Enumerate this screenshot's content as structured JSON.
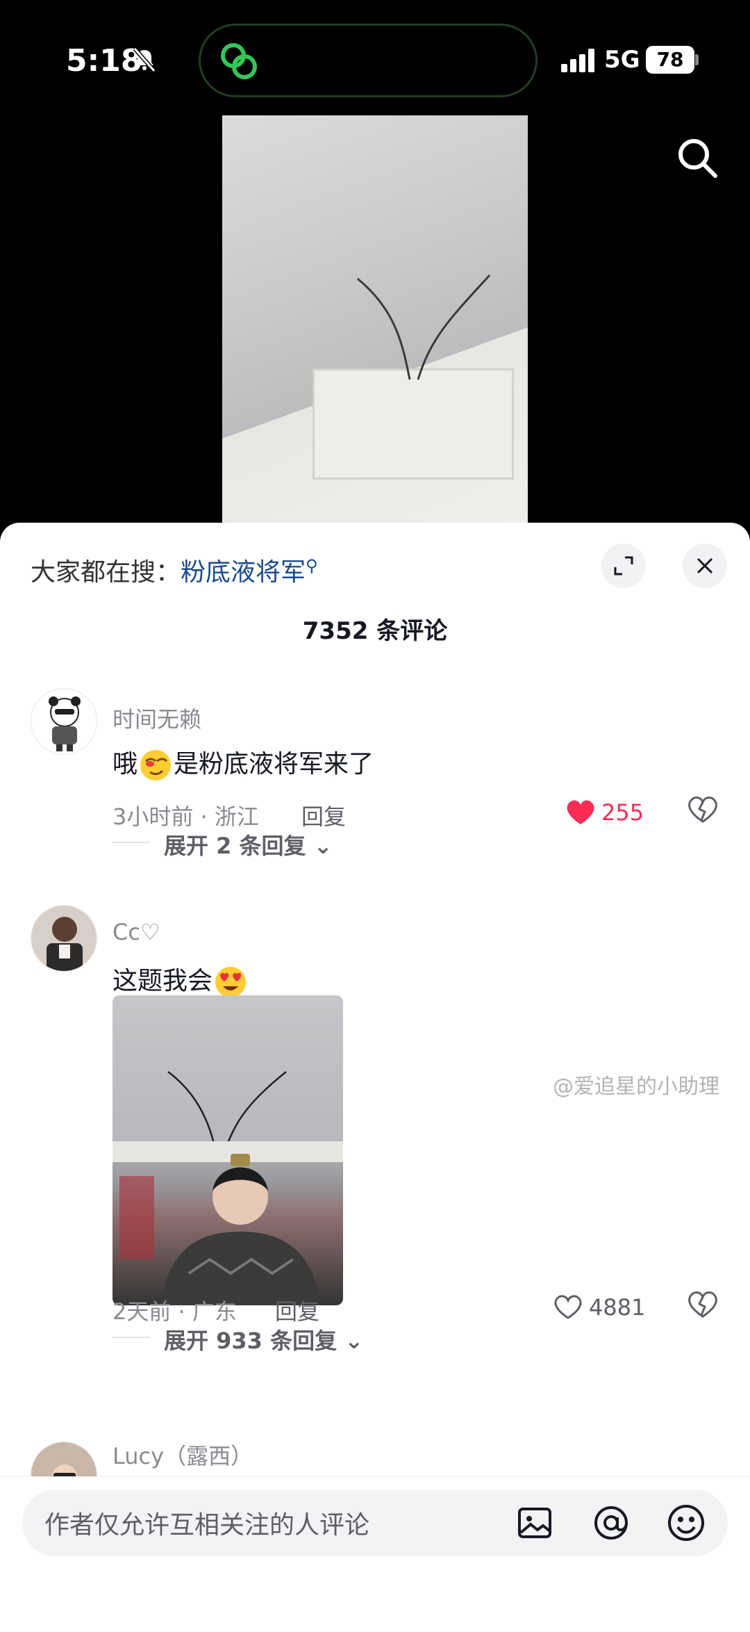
{
  "status_bar": {
    "time": "5:18",
    "network": "5G",
    "battery": "78"
  },
  "trending": {
    "prefix": "大家都在搜：",
    "query": "粉底液将军",
    "search_glyph": "⚲"
  },
  "comments_header": {
    "count_label": "7352 条评论"
  },
  "comments": [
    {
      "username": "时间无赖",
      "text_before": "哦",
      "text_after": "是粉底液将军来了",
      "meta": "3小时前 · 浙江",
      "reply_label": "回复",
      "likes": "255",
      "liked": true,
      "expand_label": "展开 2 条回复"
    },
    {
      "username": "Cc♡",
      "text": "这题我会",
      "meta": "2天前 · 广东",
      "reply_label": "回复",
      "likes": "4881",
      "liked": false,
      "expand_label": "展开 933 条回复"
    },
    {
      "username": "Lucy（露西）"
    }
  ],
  "composer": {
    "placeholder": "作者仅允许互相关注的人评论"
  },
  "watermark": "@爱追星的小助理",
  "colors": {
    "like_red": "#fe2c55",
    "link_blue": "#1a4b8c",
    "island_border": "#1f3f22",
    "island_icon": "#33c759"
  }
}
